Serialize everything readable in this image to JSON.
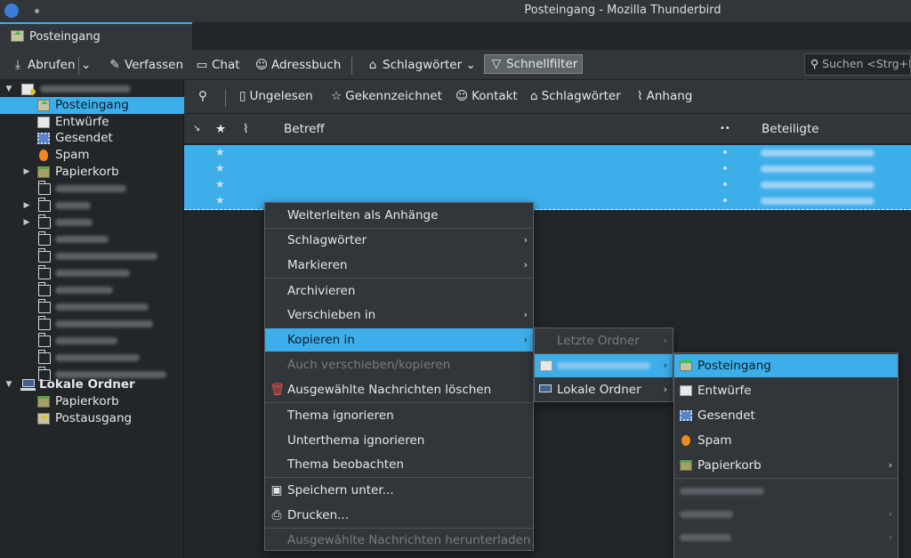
{
  "window": {
    "title": "Posteingang - Mozilla Thunderbird"
  },
  "tab": {
    "label": "Posteingang"
  },
  "toolbar": {
    "get_mail": "Abrufen",
    "compose": "Verfassen",
    "chat": "Chat",
    "address_book": "Adressbuch",
    "tags": "Schlagwörter",
    "quick_filter": "Schnellfilter",
    "search_placeholder": "Suchen <Strg+K>"
  },
  "folders": {
    "account_items": [
      {
        "label": "Posteingang"
      },
      {
        "label": "Entwürfe"
      },
      {
        "label": "Gesendet"
      },
      {
        "label": "Spam"
      },
      {
        "label": "Papierkorb"
      }
    ],
    "local_folders": "Lokale Ordner",
    "local_items": [
      {
        "label": "Papierkorb"
      },
      {
        "label": "Postausgang"
      }
    ]
  },
  "quickfilter": {
    "unread": "Ungelesen",
    "starred": "Gekennzeichnet",
    "contact": "Kontakt",
    "tags": "Schlagwörter",
    "attachment": "Anhang"
  },
  "columns": {
    "subject": "Betreff",
    "correspondents": "Beteiligte"
  },
  "context_menu": {
    "forward_as_attachments": "Weiterleiten als Anhänge",
    "tags": "Schlagwörter",
    "mark": "Markieren",
    "archive": "Archivieren",
    "move_to": "Verschieben in",
    "copy_to": "Kopieren in",
    "move_copy_again": "Auch verschieben/kopieren",
    "delete_selected": "Ausgewählte Nachrichten löschen",
    "ignore_thread": "Thema ignorieren",
    "ignore_subthread": "Unterthema ignorieren",
    "watch_thread": "Thema beobachten",
    "save_as": "Speichern unter...",
    "print": "Drucken...",
    "download_selected": "Ausgewählte Nachrichten herunterladen"
  },
  "copy_submenu": {
    "recent_folders": "Letzte Ordner",
    "local_folders": "Lokale Ordner"
  },
  "account_submenu": {
    "items": [
      {
        "label": "Posteingang"
      },
      {
        "label": "Entwürfe"
      },
      {
        "label": "Gesendet"
      },
      {
        "label": "Spam"
      },
      {
        "label": "Papierkorb"
      }
    ]
  },
  "colors": {
    "accent": "#3daee9",
    "background": "#232629",
    "panel": "#31363b"
  }
}
